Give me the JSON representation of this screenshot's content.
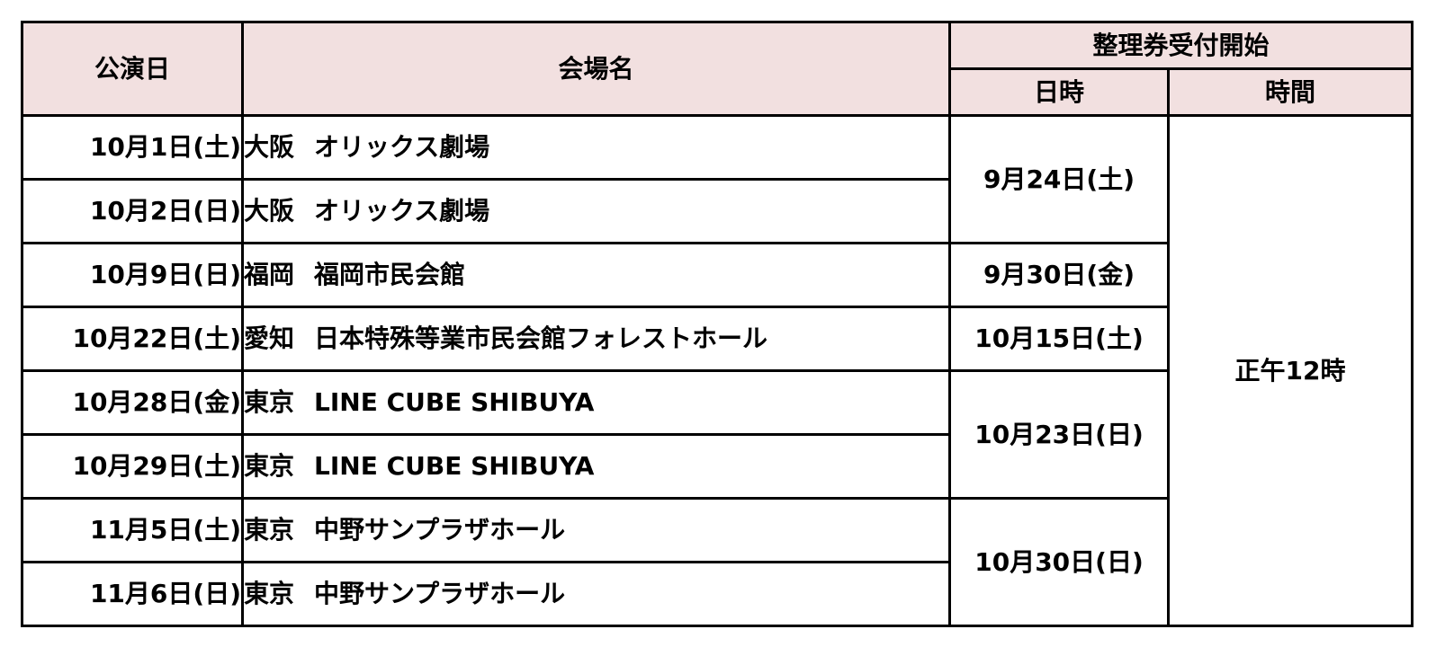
{
  "headers": {
    "performance_date": "公演日",
    "venue": "会場名",
    "ticket_start": "整理券受付開始",
    "ticket_date": "日時",
    "ticket_time": "時間"
  },
  "rows": [
    {
      "date": "10月1日(土)",
      "city": "大阪",
      "venue": "オリックス劇場"
    },
    {
      "date": "10月2日(日)",
      "city": "大阪",
      "venue": "オリックス劇場"
    },
    {
      "date": "10月9日(日)",
      "city": "福岡",
      "venue": "福岡市民会館"
    },
    {
      "date": "10月22日(土)",
      "city": "愛知",
      "venue": "日本特殊等業市民会館フォレストホール"
    },
    {
      "date": "10月28日(金)",
      "city": "東京",
      "venue": "LINE CUBE SHIBUYA"
    },
    {
      "date": "10月29日(土)",
      "city": "東京",
      "venue": "LINE CUBE SHIBUYA"
    },
    {
      "date": "11月5日(土)",
      "city": "東京",
      "venue": "中野サンプラザホール"
    },
    {
      "date": "11月6日(日)",
      "city": "東京",
      "venue": "中野サンプラザホール"
    }
  ],
  "ticket_dates": [
    "9月24日(土)",
    "9月30日(金)",
    "10月15日(土)",
    "10月23日(日)",
    "10月30日(日)"
  ],
  "ticket_time": "正午12時",
  "colors": {
    "header_bg": "#f2e0e0",
    "border": "#000000"
  }
}
